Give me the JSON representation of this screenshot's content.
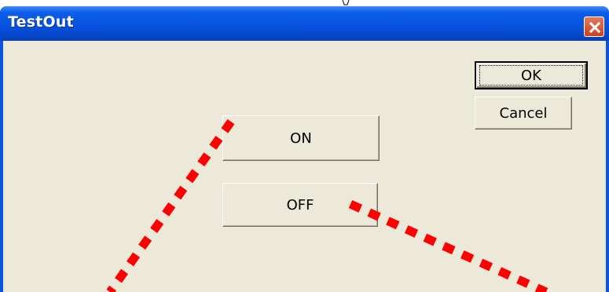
{
  "window": {
    "title": "TestOut"
  },
  "buttons": {
    "ok": "OK",
    "cancel": "Cancel",
    "on": "ON",
    "off": "OFF"
  },
  "colors": {
    "titlebar": "#0653e0",
    "client": "#ece9d8",
    "close": "#d55a3a",
    "annotation": "#ff0000"
  },
  "annotations": [
    "red-dotted-line-from-on-button",
    "red-dotted-line-from-off-button"
  ]
}
